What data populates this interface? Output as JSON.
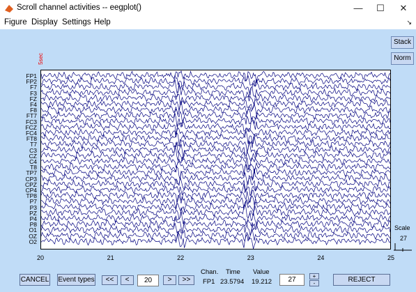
{
  "window": {
    "title": "Scroll channel activities -- eegplot()",
    "controls": [
      "—",
      "☐",
      "✕"
    ]
  },
  "menu": [
    "Figure",
    "Display",
    "Settings",
    "Help"
  ],
  "dock_arrow": "↘",
  "plot": {
    "scale_note": "5sec",
    "channels": [
      "FP1",
      "FP2",
      "F7",
      "F3",
      "FZ",
      "F4",
      "F8",
      "FT7",
      "FC3",
      "FCZ",
      "FC4",
      "FT8",
      "T7",
      "C3",
      "CZ",
      "C4",
      "T8",
      "TP7",
      "CP3",
      "CPZ",
      "CP4",
      "TP8",
      "P7",
      "P3",
      "PZ",
      "P4",
      "P8",
      "O1",
      "OZ",
      "O2"
    ],
    "x_ticks": [
      "20",
      "21",
      "22",
      "23",
      "24",
      "25"
    ],
    "trace_color": "#00007f"
  },
  "side": {
    "stack_label": "Stack",
    "norm_label": "Norm",
    "scale_label": "Scale",
    "scale_value": "27"
  },
  "controls": {
    "cancel": "CANCEL",
    "event_types": "Event types",
    "first": "<<",
    "prev": "<",
    "position": "20",
    "next": ">",
    "last": ">>",
    "chan_head": "Chan.",
    "time_head": "Time",
    "value_head": "Value",
    "chan_val": "FP1",
    "time_val": "23.5794",
    "value_val": "19.212",
    "spacing": "27",
    "plus": "+",
    "minus": "-",
    "reject": "REJECT"
  }
}
